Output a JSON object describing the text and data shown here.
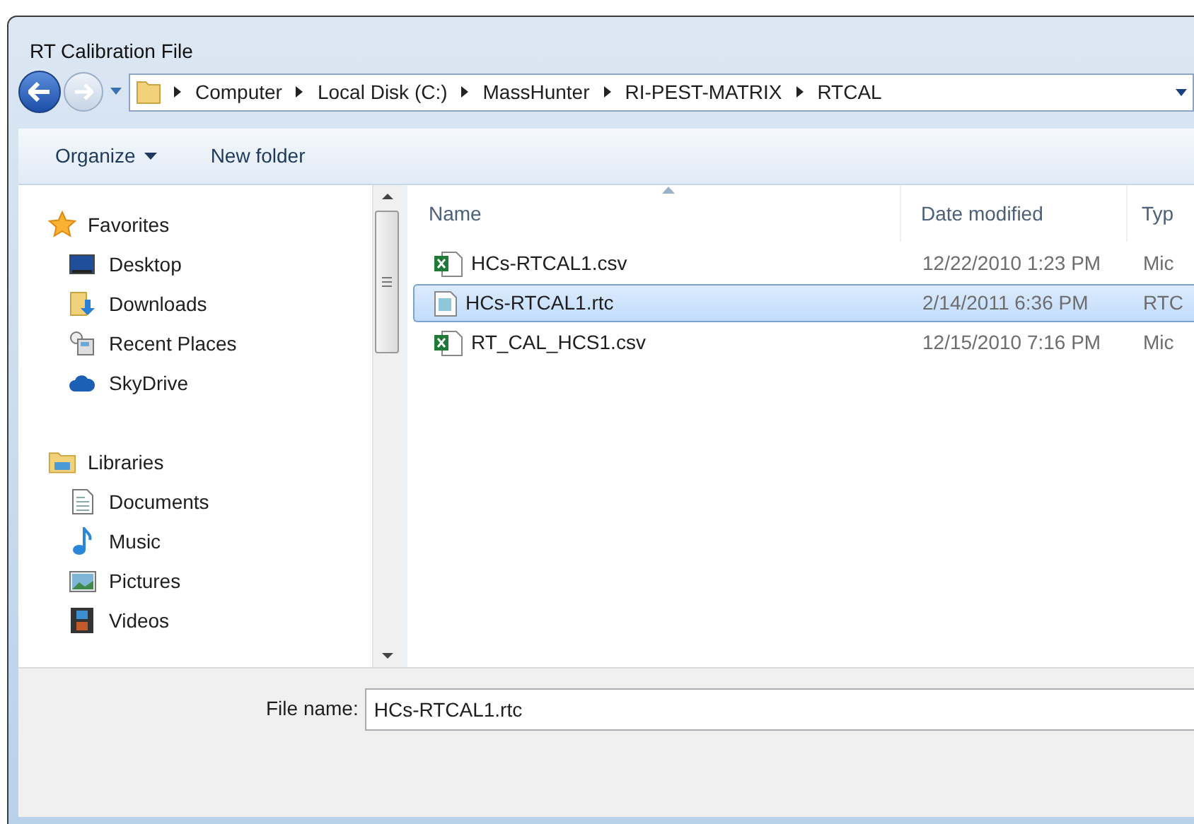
{
  "window": {
    "title": "RT Calibration File"
  },
  "breadcrumb": [
    "Computer",
    "Local Disk (C:)",
    "MassHunter",
    "RI-PEST-MATRIX",
    "RTCAL"
  ],
  "toolbar": [
    {
      "label": "Organize",
      "dropdown": true
    },
    {
      "label": "New folder",
      "dropdown": false
    }
  ],
  "sidebar": {
    "groups": [
      {
        "label": "Favorites",
        "items": [
          {
            "label": "Desktop"
          },
          {
            "label": "Downloads"
          },
          {
            "label": "Recent Places"
          },
          {
            "label": "SkyDrive"
          }
        ]
      },
      {
        "label": "Libraries",
        "items": [
          {
            "label": "Documents"
          },
          {
            "label": "Music"
          },
          {
            "label": "Pictures"
          },
          {
            "label": "Videos"
          }
        ]
      }
    ]
  },
  "table": {
    "columns": [
      "Name",
      "Date modified",
      "Typ"
    ],
    "rows": [
      {
        "kind": "spreadsheet",
        "name": "HCs-RTCAL1.csv",
        "date": "12/22/2010 1:23 PM",
        "type": "Mic",
        "selected": false
      },
      {
        "kind": "document",
        "name": "HCs-RTCAL1.rtc",
        "date": "2/14/2011 6:36 PM",
        "type": "RTC",
        "selected": true
      },
      {
        "kind": "spreadsheet",
        "name": "RT_CAL_HCS1.csv",
        "date": "12/15/2010 7:16 PM",
        "type": "Mic",
        "selected": false
      }
    ]
  },
  "file_name": {
    "label": "File name:",
    "value": "HCs-RTCAL1.rtc"
  }
}
